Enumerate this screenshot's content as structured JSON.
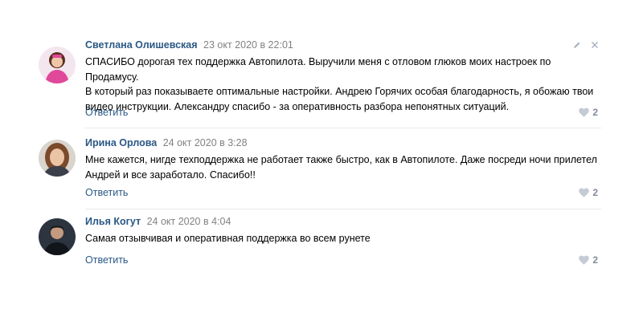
{
  "comments": [
    {
      "author": "Светлана Олишевская",
      "date": "23 окт 2020 в 22:01",
      "lines": [
        "СПАСИБО дорогая тех поддержка Автопилота. Выручили меня с отловом глюков моих настроек по Продамусу.",
        "В который раз показываете оптимальные настройки. Андрею Горячих особая благодарность, я обожаю твои",
        "видео инструкции. Александру спасибо - за оперативность разбора непонятных ситуаций."
      ],
      "reply_label": "Ответить",
      "likes": "2",
      "avatar_icon": "avatar-woman-pink-icon"
    },
    {
      "author": "Ирина Орлова",
      "date": "24 окт 2020 в 3:28",
      "lines": [
        "Мне кажется, нигде техподдержка не работает также быстро, как в Автопилоте. Даже посреди ночи прилетел",
        "Андрей и все заработало. Спасибо!!"
      ],
      "reply_label": "Ответить",
      "likes": "2",
      "avatar_icon": "avatar-woman-brown-hair-icon"
    },
    {
      "author": "Илья Когут",
      "date": "24 окт 2020 в 4:04",
      "lines": [
        "Самая отзывчивая и оперативная поддержка во всем рунете"
      ],
      "reply_label": "Ответить",
      "likes": "2",
      "avatar_icon": "avatar-man-dark-icon"
    }
  ],
  "actions": {
    "edit_icon": "pencil-icon",
    "delete_icon": "close-icon"
  },
  "colors": {
    "author": "#2a5885",
    "date": "#828282",
    "reply": "#2a5885",
    "likes": "#828a99",
    "heart": "#c4cbd4",
    "divider": "#e7e8ec"
  }
}
